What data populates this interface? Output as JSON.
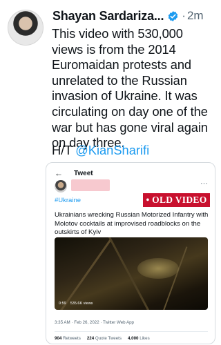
{
  "tweet": {
    "author_name": "Shayan Sardariza...",
    "time": "2m",
    "separator": "·",
    "text": "This video with 530,000 views is from the 2014 Euromaidan protests and unrelated to the Russian invasion of Ukraine. It was circulating on day one of the war but has gone viral again on day three.",
    "ht_prefix": "H/T ",
    "ht_mention": "@KianSharifi"
  },
  "embedded": {
    "back_icon": "←",
    "title": "Tweet",
    "more_icon": "···",
    "hashtag": "#Ukraine",
    "overlay_label": "• OLD VIDEO",
    "headline": "Ukrainians wrecking Russian Motorized Infantry with Molotov cocktails at improvised roadblocks on the outskirts of Kyiv",
    "video_duration": "0:59",
    "video_views": "535.6K views",
    "timestamp": "3:35 AM · Feb 26, 2022 · Twitter Web App",
    "retweets_count": "904",
    "retweets_label": "Retweets",
    "quotes_count": "224",
    "quotes_label": "Quote Tweets",
    "likes_count": "4,000",
    "likes_label": "Likes"
  },
  "colors": {
    "link": "#1d9bf0",
    "overlay_red": "#c8102e",
    "secondary_text": "#536471"
  }
}
